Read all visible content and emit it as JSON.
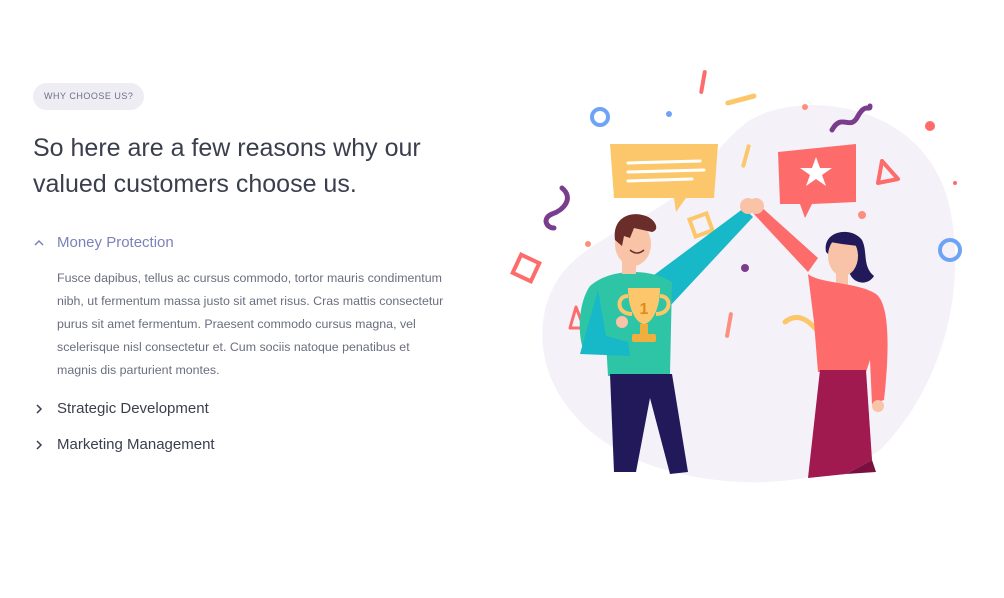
{
  "section": {
    "badge": "WHY CHOOSE US?",
    "title_line1": "So here are a few reasons why our",
    "title_line2": "valued customers choose us."
  },
  "accordion": [
    {
      "title": "Money Protection",
      "expanded": true,
      "body": "Fusce dapibus, tellus ac cursus commodo, tortor mauris condimentum nibh, ut fermentum massa justo sit amet risus. Cras mattis consectetur purus sit amet fermentum. Praesent commodo cursus magna, vel scelerisque nisl consectetur et. Cum sociis natoque penatibus et magnis dis parturient montes."
    },
    {
      "title": "Strategic Development",
      "expanded": false
    },
    {
      "title": "Marketing Management",
      "expanded": false
    }
  ],
  "illustration": {
    "trophy_number": "1"
  },
  "colors": {
    "accent": "#7a82b8",
    "heading": "#3b3f4d",
    "body_text": "#6a6e7e",
    "badge_bg": "#eeedf4",
    "blob": "#f4f1f8"
  }
}
